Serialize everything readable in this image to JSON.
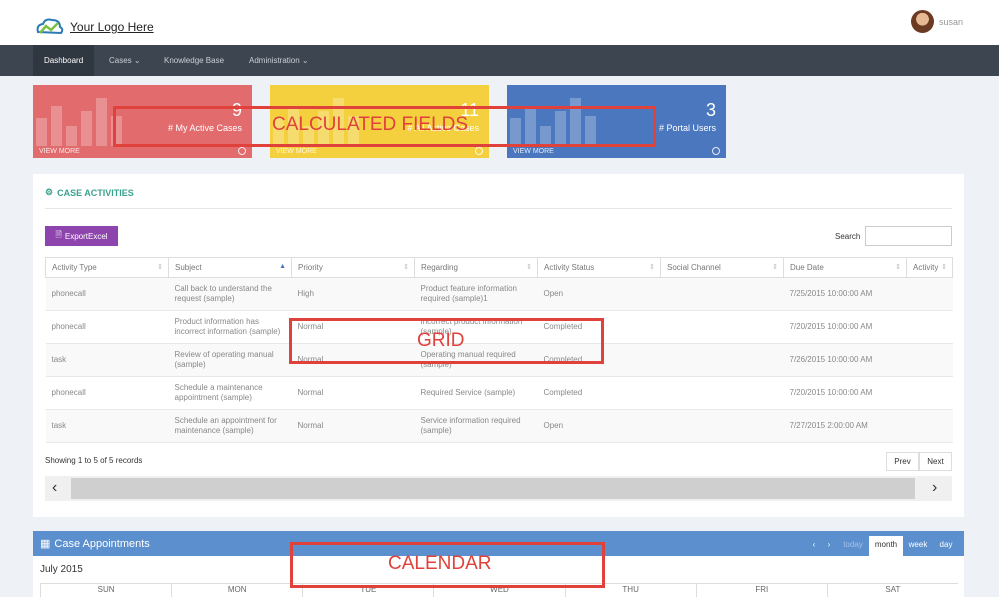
{
  "header": {
    "logo_text": "Your Logo Here",
    "username": "susan"
  },
  "nav": [
    {
      "label": "Dashboard"
    },
    {
      "label": "Cases ⌄"
    },
    {
      "label": "Knowledge Base"
    },
    {
      "label": "Administration ⌄"
    }
  ],
  "tiles": [
    {
      "value": "9",
      "label": "# My Active Cases",
      "more": "VIEW MORE",
      "color": "#e26b6e"
    },
    {
      "value": "11",
      "label": "# All Active Cases",
      "more": "VIEW MORE",
      "color": "#f4d03f"
    },
    {
      "value": "3",
      "label": "# Portal Users",
      "more": "VIEW MORE",
      "color": "#4b77be"
    }
  ],
  "annotations": {
    "calculated": "CALCULATED FIELDS",
    "grid": "GRID",
    "calendar": "CALENDAR"
  },
  "activities": {
    "title": "CASE ACTIVITIES",
    "export_label": "ExportExcel",
    "search_label": "Search",
    "columns": [
      "Activity Type",
      "Subject",
      "Priority",
      "Regarding",
      "Activity Status",
      "Social Channel",
      "Due Date",
      "Activity"
    ],
    "rows": [
      [
        "phonecall",
        "Call back to understand the request (sample)",
        "High",
        "Product feature information required (sample)1",
        "Open",
        "",
        "7/25/2015 10:00:00 AM",
        ""
      ],
      [
        "phonecall",
        "Product information has incorrect information (sample)",
        "Normal",
        "Incorrect product information (sample)",
        "Completed",
        "",
        "7/20/2015 10:00:00 AM",
        ""
      ],
      [
        "task",
        "Review of operating manual (sample)",
        "Normal",
        "Operating manual required (sample)",
        "Completed",
        "",
        "7/26/2015 10:00:00 AM",
        ""
      ],
      [
        "phonecall",
        "Schedule a maintenance appointment (sample)",
        "Normal",
        "Required Service (sample)",
        "Completed",
        "",
        "7/20/2015 10:00:00 AM",
        ""
      ],
      [
        "task",
        "Schedule an appointment for maintenance (sample)",
        "Normal",
        "Service information required (sample)",
        "Open",
        "",
        "7/27/2015 2:00:00 AM",
        ""
      ]
    ],
    "showing": "Showing 1 to 5 of 5 records",
    "prev": "Prev",
    "next": "Next"
  },
  "calendar": {
    "title": "Case Appointments",
    "month": "July 2015",
    "prev": "‹",
    "next": "›",
    "today": "today",
    "views": [
      "month",
      "week",
      "day"
    ],
    "days": [
      "SUN",
      "MON",
      "TUE",
      "WED",
      "THU",
      "FRI",
      "SAT"
    ]
  }
}
